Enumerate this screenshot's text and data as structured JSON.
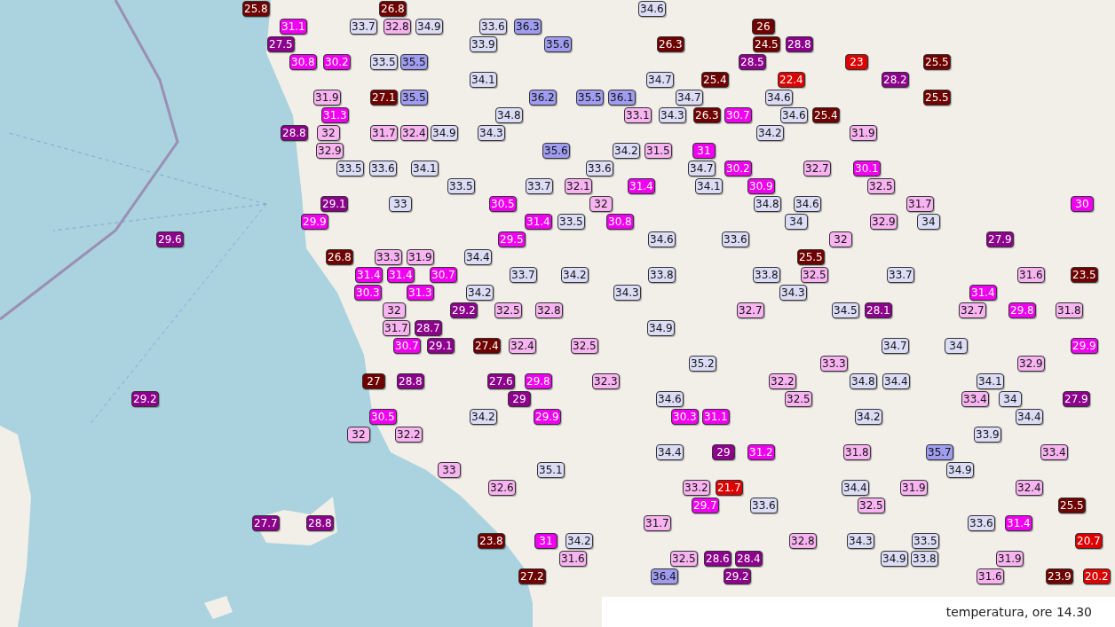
{
  "map": {
    "markers": [
      {
        "value": "25.8",
        "color": "#6e0000"
      },
      {
        "value": "26.8",
        "color": "#6e0000"
      },
      {
        "value": "34.6",
        "color": "#dcdcf6"
      },
      {
        "value": "31.1",
        "color": "#f000f0"
      },
      {
        "value": "33.7",
        "color": "#dcdcf6"
      },
      {
        "value": "32.8",
        "color": "#f8b4f0"
      },
      {
        "value": "34.9",
        "color": "#dcdcf6"
      },
      {
        "value": "33.6",
        "color": "#dcdcf6"
      },
      {
        "value": "36.3",
        "color": "#a09cf0"
      },
      {
        "value": "26",
        "color": "#6e0000"
      },
      {
        "value": "27.5",
        "color": "#8c008c"
      },
      {
        "value": "33.9",
        "color": "#dcdcf6"
      },
      {
        "value": "35.6",
        "color": "#a09cf0"
      },
      {
        "value": "26.3",
        "color": "#6e0000"
      },
      {
        "value": "24.5",
        "color": "#6e0000"
      },
      {
        "value": "28.8",
        "color": "#8c008c"
      },
      {
        "value": "30.8",
        "color": "#f000f0"
      },
      {
        "value": "30.2",
        "color": "#f000f0"
      },
      {
        "value": "33.5",
        "color": "#dcdcf6"
      },
      {
        "value": "35.5",
        "color": "#a09cf0"
      },
      {
        "value": "28.5",
        "color": "#8c008c"
      },
      {
        "value": "23",
        "color": "#dc0000"
      },
      {
        "value": "25.5",
        "color": "#6e0000"
      },
      {
        "value": "34.1",
        "color": "#dcdcf6"
      },
      {
        "value": "34.7",
        "color": "#dcdcf6"
      },
      {
        "value": "25.4",
        "color": "#6e0000"
      },
      {
        "value": "22.4",
        "color": "#dc0000"
      },
      {
        "value": "28.2",
        "color": "#8c008c"
      },
      {
        "value": "31.9",
        "color": "#f8b4f0"
      },
      {
        "value": "27.1",
        "color": "#6e0000"
      },
      {
        "value": "35.5",
        "color": "#a09cf0"
      },
      {
        "value": "36.2",
        "color": "#a09cf0"
      },
      {
        "value": "35.5",
        "color": "#a09cf0"
      },
      {
        "value": "36.1",
        "color": "#a09cf0"
      },
      {
        "value": "34.7",
        "color": "#dcdcf6"
      },
      {
        "value": "34.6",
        "color": "#dcdcf6"
      },
      {
        "value": "25.5",
        "color": "#6e0000"
      },
      {
        "value": "31.3",
        "color": "#f000f0"
      },
      {
        "value": "34.8",
        "color": "#dcdcf6"
      },
      {
        "value": "33.1",
        "color": "#f8b4f0"
      },
      {
        "value": "34.3",
        "color": "#dcdcf6"
      },
      {
        "value": "26.3",
        "color": "#6e0000"
      },
      {
        "value": "30.7",
        "color": "#f000f0"
      },
      {
        "value": "34.6",
        "color": "#dcdcf6"
      },
      {
        "value": "25.4",
        "color": "#6e0000"
      },
      {
        "value": "28.8",
        "color": "#8c008c"
      },
      {
        "value": "32",
        "color": "#f8b4f0"
      },
      {
        "value": "31.7",
        "color": "#f8b4f0"
      },
      {
        "value": "32.4",
        "color": "#f8b4f0"
      },
      {
        "value": "34.9",
        "color": "#dcdcf6"
      },
      {
        "value": "34.3",
        "color": "#dcdcf6"
      },
      {
        "value": "34.2",
        "color": "#dcdcf6"
      },
      {
        "value": "31.9",
        "color": "#f8b4f0"
      },
      {
        "value": "32.9",
        "color": "#f8b4f0"
      },
      {
        "value": "35.6",
        "color": "#a09cf0"
      },
      {
        "value": "34.2",
        "color": "#dcdcf6"
      },
      {
        "value": "31.5",
        "color": "#f8b4f0"
      },
      {
        "value": "31",
        "color": "#f000f0"
      },
      {
        "value": "33.5",
        "color": "#dcdcf6"
      },
      {
        "value": "33.6",
        "color": "#dcdcf6"
      },
      {
        "value": "34.1",
        "color": "#dcdcf6"
      },
      {
        "value": "33.6",
        "color": "#dcdcf6"
      },
      {
        "value": "34.7",
        "color": "#dcdcf6"
      },
      {
        "value": "30.2",
        "color": "#f000f0"
      },
      {
        "value": "32.7",
        "color": "#f8b4f0"
      },
      {
        "value": "30.1",
        "color": "#f000f0"
      },
      {
        "value": "33.5",
        "color": "#dcdcf6"
      },
      {
        "value": "33.7",
        "color": "#dcdcf6"
      },
      {
        "value": "32.1",
        "color": "#f8b4f0"
      },
      {
        "value": "31.4",
        "color": "#f000f0"
      },
      {
        "value": "34.1",
        "color": "#dcdcf6"
      },
      {
        "value": "30.9",
        "color": "#f000f0"
      },
      {
        "value": "32.5",
        "color": "#f8b4f0"
      },
      {
        "value": "29.1",
        "color": "#8c008c"
      },
      {
        "value": "33",
        "color": "#dcdcf6"
      },
      {
        "value": "30.5",
        "color": "#f000f0"
      },
      {
        "value": "32",
        "color": "#f8b4f0"
      },
      {
        "value": "34.8",
        "color": "#dcdcf6"
      },
      {
        "value": "34.6",
        "color": "#dcdcf6"
      },
      {
        "value": "31.7",
        "color": "#f8b4f0"
      },
      {
        "value": "30",
        "color": "#f000f0"
      },
      {
        "value": "29.9",
        "color": "#f000f0"
      },
      {
        "value": "31.4",
        "color": "#f000f0"
      },
      {
        "value": "33.5",
        "color": "#dcdcf6"
      },
      {
        "value": "30.8",
        "color": "#f000f0"
      },
      {
        "value": "34",
        "color": "#dcdcf6"
      },
      {
        "value": "32.9",
        "color": "#f8b4f0"
      },
      {
        "value": "34",
        "color": "#dcdcf6"
      },
      {
        "value": "29.6",
        "color": "#8c008c"
      },
      {
        "value": "29.5",
        "color": "#f000f0"
      },
      {
        "value": "34.6",
        "color": "#dcdcf6"
      },
      {
        "value": "33.6",
        "color": "#dcdcf6"
      },
      {
        "value": "32",
        "color": "#f8b4f0"
      },
      {
        "value": "27.9",
        "color": "#8c008c"
      },
      {
        "value": "26.8",
        "color": "#6e0000"
      },
      {
        "value": "33.3",
        "color": "#f8b4f0"
      },
      {
        "value": "31.9",
        "color": "#f8b4f0"
      },
      {
        "value": "34.4",
        "color": "#dcdcf6"
      },
      {
        "value": "25.5",
        "color": "#6e0000"
      },
      {
        "value": "31.4",
        "color": "#f000f0"
      },
      {
        "value": "31.4",
        "color": "#f000f0"
      },
      {
        "value": "30.7",
        "color": "#f000f0"
      },
      {
        "value": "33.7",
        "color": "#dcdcf6"
      },
      {
        "value": "34.2",
        "color": "#dcdcf6"
      },
      {
        "value": "33.8",
        "color": "#dcdcf6"
      },
      {
        "value": "33.8",
        "color": "#dcdcf6"
      },
      {
        "value": "32.5",
        "color": "#f8b4f0"
      },
      {
        "value": "33.7",
        "color": "#dcdcf6"
      },
      {
        "value": "31.6",
        "color": "#f8b4f0"
      },
      {
        "value": "23.5",
        "color": "#6e0000"
      },
      {
        "value": "30.3",
        "color": "#f000f0"
      },
      {
        "value": "31.3",
        "color": "#f000f0"
      },
      {
        "value": "34.2",
        "color": "#dcdcf6"
      },
      {
        "value": "34.3",
        "color": "#dcdcf6"
      },
      {
        "value": "34.3",
        "color": "#dcdcf6"
      },
      {
        "value": "31.4",
        "color": "#f000f0"
      },
      {
        "value": "32",
        "color": "#f8b4f0"
      },
      {
        "value": "29.2",
        "color": "#8c008c"
      },
      {
        "value": "32.5",
        "color": "#f8b4f0"
      },
      {
        "value": "32.8",
        "color": "#f8b4f0"
      },
      {
        "value": "32.7",
        "color": "#f8b4f0"
      },
      {
        "value": "34.5",
        "color": "#dcdcf6"
      },
      {
        "value": "28.1",
        "color": "#8c008c"
      },
      {
        "value": "32.7",
        "color": "#f8b4f0"
      },
      {
        "value": "29.8",
        "color": "#f000f0"
      },
      {
        "value": "31.8",
        "color": "#f8b4f0"
      },
      {
        "value": "31.7",
        "color": "#f8b4f0"
      },
      {
        "value": "28.7",
        "color": "#8c008c"
      },
      {
        "value": "34.9",
        "color": "#dcdcf6"
      },
      {
        "value": "30.7",
        "color": "#f000f0"
      },
      {
        "value": "29.1",
        "color": "#8c008c"
      },
      {
        "value": "27.4",
        "color": "#6e0000"
      },
      {
        "value": "32.4",
        "color": "#f8b4f0"
      },
      {
        "value": "32.5",
        "color": "#f8b4f0"
      },
      {
        "value": "34.7",
        "color": "#dcdcf6"
      },
      {
        "value": "34",
        "color": "#dcdcf6"
      },
      {
        "value": "29.9",
        "color": "#f000f0"
      },
      {
        "value": "35.2",
        "color": "#dcdcf6"
      },
      {
        "value": "33.3",
        "color": "#f8b4f0"
      },
      {
        "value": "32.9",
        "color": "#f8b4f0"
      },
      {
        "value": "27",
        "color": "#6e0000"
      },
      {
        "value": "28.8",
        "color": "#8c008c"
      },
      {
        "value": "27.6",
        "color": "#8c008c"
      },
      {
        "value": "29.8",
        "color": "#f000f0"
      },
      {
        "value": "32.3",
        "color": "#f8b4f0"
      },
      {
        "value": "32.2",
        "color": "#f8b4f0"
      },
      {
        "value": "34.8",
        "color": "#dcdcf6"
      },
      {
        "value": "34.4",
        "color": "#dcdcf6"
      },
      {
        "value": "34.1",
        "color": "#dcdcf6"
      },
      {
        "value": "29.2",
        "color": "#8c008c"
      },
      {
        "value": "29",
        "color": "#8c008c"
      },
      {
        "value": "34.6",
        "color": "#dcdcf6"
      },
      {
        "value": "32.5",
        "color": "#f8b4f0"
      },
      {
        "value": "33.4",
        "color": "#f8b4f0"
      },
      {
        "value": "34",
        "color": "#dcdcf6"
      },
      {
        "value": "27.9",
        "color": "#8c008c"
      },
      {
        "value": "30.5",
        "color": "#f000f0"
      },
      {
        "value": "34.2",
        "color": "#dcdcf6"
      },
      {
        "value": "29.9",
        "color": "#f000f0"
      },
      {
        "value": "30.3",
        "color": "#f000f0"
      },
      {
        "value": "31.1",
        "color": "#f000f0"
      },
      {
        "value": "34.2",
        "color": "#dcdcf6"
      },
      {
        "value": "34.4",
        "color": "#dcdcf6"
      },
      {
        "value": "32",
        "color": "#f8b4f0"
      },
      {
        "value": "32.2",
        "color": "#f8b4f0"
      },
      {
        "value": "33.9",
        "color": "#dcdcf6"
      },
      {
        "value": "34.4",
        "color": "#dcdcf6"
      },
      {
        "value": "29",
        "color": "#8c008c"
      },
      {
        "value": "31.2",
        "color": "#f000f0"
      },
      {
        "value": "31.8",
        "color": "#f8b4f0"
      },
      {
        "value": "35.7",
        "color": "#a09cf0"
      },
      {
        "value": "33.4",
        "color": "#f8b4f0"
      },
      {
        "value": "33",
        "color": "#f8b4f0"
      },
      {
        "value": "35.1",
        "color": "#dcdcf6"
      },
      {
        "value": "34.9",
        "color": "#dcdcf6"
      },
      {
        "value": "32.6",
        "color": "#f8b4f0"
      },
      {
        "value": "33.2",
        "color": "#f8b4f0"
      },
      {
        "value": "21.7",
        "color": "#dc0000"
      },
      {
        "value": "34.4",
        "color": "#dcdcf6"
      },
      {
        "value": "31.9",
        "color": "#f8b4f0"
      },
      {
        "value": "32.4",
        "color": "#f8b4f0"
      },
      {
        "value": "29.7",
        "color": "#f000f0"
      },
      {
        "value": "33.6",
        "color": "#dcdcf6"
      },
      {
        "value": "32.5",
        "color": "#f8b4f0"
      },
      {
        "value": "25.5",
        "color": "#6e0000"
      },
      {
        "value": "27.7",
        "color": "#8c008c"
      },
      {
        "value": "28.8",
        "color": "#8c008c"
      },
      {
        "value": "31.7",
        "color": "#f8b4f0"
      },
      {
        "value": "33.6",
        "color": "#dcdcf6"
      },
      {
        "value": "31.4",
        "color": "#f000f0"
      },
      {
        "value": "23.8",
        "color": "#6e0000"
      },
      {
        "value": "31",
        "color": "#f000f0"
      },
      {
        "value": "34.2",
        "color": "#dcdcf6"
      },
      {
        "value": "32.8",
        "color": "#f8b4f0"
      },
      {
        "value": "34.3",
        "color": "#dcdcf6"
      },
      {
        "value": "33.5",
        "color": "#dcdcf6"
      },
      {
        "value": "20.7",
        "color": "#dc0000"
      },
      {
        "value": "31.6",
        "color": "#f8b4f0"
      },
      {
        "value": "32.5",
        "color": "#f8b4f0"
      },
      {
        "value": "28.6",
        "color": "#8c008c"
      },
      {
        "value": "28.4",
        "color": "#8c008c"
      },
      {
        "value": "34.9",
        "color": "#dcdcf6"
      },
      {
        "value": "33.8",
        "color": "#dcdcf6"
      },
      {
        "value": "31.9",
        "color": "#f8b4f0"
      },
      {
        "value": "27.2",
        "color": "#6e0000"
      },
      {
        "value": "36.4",
        "color": "#a09cf0"
      },
      {
        "value": "29.2",
        "color": "#8c008c"
      },
      {
        "value": "31.6",
        "color": "#f8b4f0"
      },
      {
        "value": "23.9",
        "color": "#6e0000"
      },
      {
        "value": "20.2",
        "color": "#dc0000"
      }
    ]
  },
  "legend": {
    "caption": "temperatura, ore 14.30"
  }
}
